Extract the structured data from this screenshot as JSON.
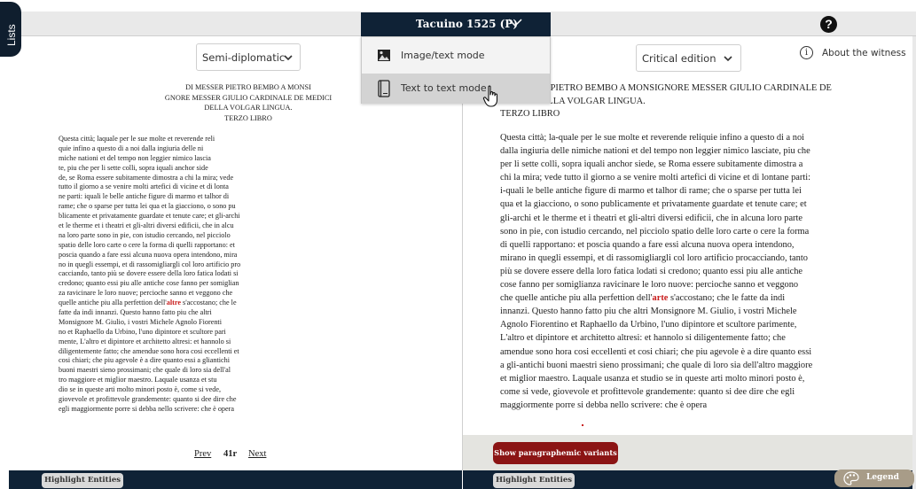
{
  "sidebar": {
    "lists_label": "Lists"
  },
  "header": {
    "witness_label": "Tacuino 1525 (P)",
    "help_label": "?"
  },
  "view_menu": {
    "items": [
      {
        "label": "Image/text mode",
        "icon": "image-icon"
      },
      {
        "label": "Text to text mode",
        "icon": "book-icon"
      }
    ]
  },
  "left_panel": {
    "edition_select": "Semi-diplomatic",
    "heading": [
      "DI MESSER PIETRO BEMBO A MONSI",
      "GNORE MESSER GIULIO CARDINALE DE MEDICI",
      "DELLA VOLGAR LINGUA.",
      "TERZO LIBRO"
    ],
    "lines": [
      "Questa città; laquale per le sue molte et reverende reli",
      "quie infino a questo di a noi dalla ingiuria delle ni",
      "miche nationi et del tempo non leggier nimico lascia",
      "te, piu che per li sette colli, sopra iquali anchor side",
      "de, se Roma essere subitamente dimostra a chi la mira; vede",
      "tutto il giorno a se venire molti artefici di vicine et di lonta",
      "ne parti: iquali le belle antiche figure di marmo et talhor di",
      "rame; che o sparse per tutta lei qua et la giacciono, o sono pu",
      "blicamente et privatamente guardate et tenute care; et gli-archi",
      "et le therme et i theatri et gli-altri diversi edificii, che in alcu",
      "na loro parte sono in pie, con istudio cercando, nel picciolo",
      "spatio delle loro carte o cere la forma di quelli rapportano: et",
      "poscia quando a fare essi alcuna nuova opera intendono, mira",
      "no in quegli essempi, et di rassomigliargli col loro artificio pro",
      "cacciando, tanto più se dovere essere della loro fatica lodati si",
      "credono; quanto essi piu alle antiche cose fanno per somiglian",
      "za ravicinare le loro nuove; percioche sanno et veggono che",
      "quelle antiche piu alla perfettion dell'|altre| s'accostano; che le",
      "fatte da indi innanzi. Questo hanno fatto piu che altri",
      "Monsignore M. Giulio, i vostri Michele Agnolo Fiorenti",
      "no et Raphaello da Urbino, l'uno dipintore et scultore pari",
      "mente, L'altro et dipintore et architetto altresi: et hannolo si",
      "diligentemente fatto; che amendue sono hora cosi eccellenti et",
      "cosi chiari; che piu agevole è a dire quanto essi a gliantichi",
      "buoni maestri sieno prossimani; che quale di loro sia dell'al",
      "tro maggiore et miglior maestro. Laquale usanza et stu",
      "dio se in queste arti molto minori posto è, come si vede,",
      "giovevole et profittevole grandemente: quanto si dee dire che",
      "egli maggiormente porre si debba nello scrivere: che è opera"
    ],
    "pager": {
      "prev": "Prev",
      "page": "41r",
      "next": "Next"
    },
    "highlight_label": "Highlight Entities"
  },
  "right_panel": {
    "edition_select": "Critical edition",
    "about_label": "About the witness",
    "heading": [
      "DI MESSER PIETRO BEMBO A MONSIGNORE MESSER GIULIO CARDINALE DE",
      "MEDICI DELLA VOLGAR LINGUA.",
      "TERZO LIBRO"
    ],
    "lines": [
      "Questa città; la-quale per le sue molte et reverende reliquie infino a questo di a noi",
      "dalla ingiuria delle nimiche nationi et del tempo non leggier nimico lasciate, piu che",
      "per li sette colli, sopra iquali anchor siede, se Roma essere subitamente dimostra a",
      "chi la mira; vede tutto il giorno a se venire molti artefici di vicine et di lontane parti:",
      "i-quali le belle antiche figure di marmo et talhor di rame; che o sparse per tutta lei",
      "qua et la giacciono, o sono publicamente et privatamente guardate et tenute care; et",
      "gli-archi et le therme et i theatri et gli-altri diversi edificii, che in alcuna loro parte",
      "sono in pie, con istudio cercando, nel picciolo spatio delle loro carte o cere la forma",
      "di quelli rapportano: et poscia quando a fare essi alcuna nuova opera intendono,",
      "mirano in quegli essempi, et di rassomigliargli col loro artificio procacciando, tanto",
      "più se dovere essere della loro fatica lodati si credono; quanto essi piu alle antiche",
      "cose fanno per somiglianza ravicinare le loro nuove: percioche sanno et veggono",
      "che quelle antiche piu alla perfettion dell'|arte| s'accostano; che le fatte da indi",
      "innanzi. Questo hanno fatto piu che altri Monsignore M. Giulio, i vostri Michele",
      "Agnolo Fiorentino et Raphaello da Urbino, l'uno dipintore et scultore parimente,",
      "L'altro et dipintore et architetto altresi: et hannolo si diligentemente fatto; che",
      "amendue sono hora cosi eccellenti et cosi chiari; che piu agevole è a dire quanto essi",
      "a gli-antichi buoni maestri sieno prossimani; che quale di loro sia dell'altro maggiore",
      "et miglior maestro. Laquale usanza et studio se in queste arti molto minori posto è,",
      "come si vede, giovevole et profittevole grandemente: quanto si dee dire che egli",
      "maggiormente porre si debba nello scrivere: che è opera"
    ],
    "variants_label": "Show paragraphemic variants",
    "highlight_label": "Highlight Entities",
    "legend_label": "Legend"
  },
  "colors": {
    "navy": "#0f2236",
    "variant_red": "#8b1414",
    "emphasis_red": "#c81b1b",
    "legend_tan": "#a89c88"
  }
}
